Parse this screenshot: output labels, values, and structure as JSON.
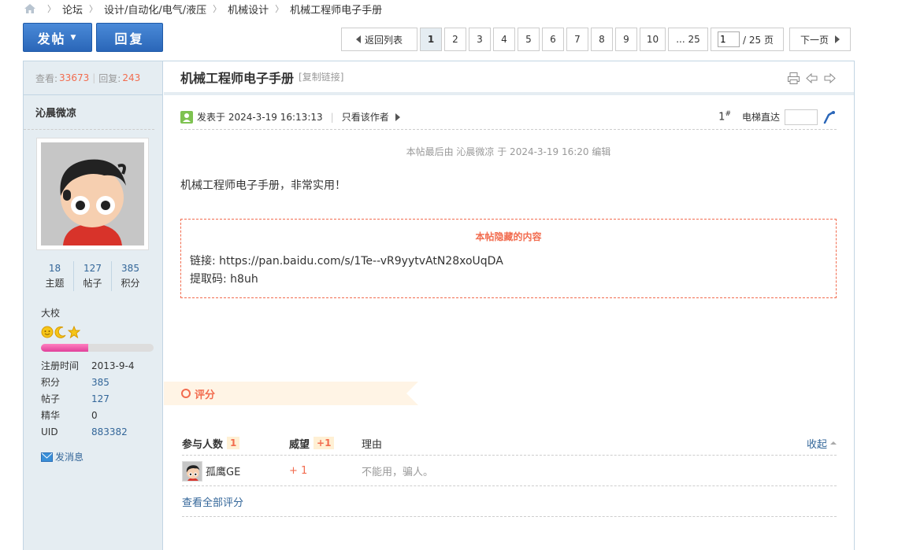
{
  "breadcrumb": {
    "items": [
      "论坛",
      "设计/自动化/电气/液压",
      "机械设计",
      "机械工程师电子手册"
    ]
  },
  "toolbar": {
    "post_label": "发帖",
    "reply_label": "回复"
  },
  "pager": {
    "back_label": "返回列表",
    "pages": [
      "1",
      "2",
      "3",
      "4",
      "5",
      "6",
      "7",
      "8",
      "9"
    ],
    "page_ten": "10",
    "last": "... 25",
    "jump_value": "1",
    "total": "/ 25 页",
    "next_label": "下一页"
  },
  "side": {
    "views_label": "查看:",
    "views": "33673",
    "replies_label": "回复:",
    "replies": "243",
    "username": "沁晨微凉",
    "counts": [
      {
        "n": "18",
        "l": "主题"
      },
      {
        "n": "127",
        "l": "帖子"
      },
      {
        "n": "385",
        "l": "积分"
      }
    ],
    "rank": "大校",
    "progress": 0.42,
    "info": [
      {
        "k": "注册时间",
        "v": "2013-9-4",
        "link": false
      },
      {
        "k": "积分",
        "v": "385",
        "link": true
      },
      {
        "k": "帖子",
        "v": "127",
        "link": true
      },
      {
        "k": "精华",
        "v": "0",
        "link": false
      },
      {
        "k": "UID",
        "v": "883382",
        "link": true
      }
    ],
    "pm_label": "发消息"
  },
  "post": {
    "title": "机械工程师电子手册",
    "copy_link": "[复制链接]",
    "posted": "发表于 2024-3-19 16:13:13",
    "only_author": "只看该作者",
    "floor": "1",
    "floor_mark": "#",
    "lift_label": "电梯直达",
    "edited": "本帖最后由 沁晨微凉 于 2024-3-19 16:20 编辑",
    "body": "机械工程师电子手册，非常实用！",
    "hidden_title": "本帖隐藏的内容",
    "link_line": "链接: https://pan.baidu.com/s/1Te--vR9yytvAtN28xoUqDA",
    "code_line": "提取码: h8uh"
  },
  "rating": {
    "tab_label": "评分",
    "participants_label": "参与人数",
    "participants": "1",
    "prestige_label": "威望",
    "prestige": "+1",
    "reason_label": "理由",
    "collapse_label": "收起",
    "rows": [
      {
        "user": "孤鹰GE",
        "points": "+ 1",
        "reason": "不能用，骗人。"
      }
    ],
    "view_all": "查看全部评分"
  },
  "colors": {
    "accent_blue": "#2a66b8",
    "highlight": "#f26c4f",
    "side_bg": "#e5edf2"
  }
}
